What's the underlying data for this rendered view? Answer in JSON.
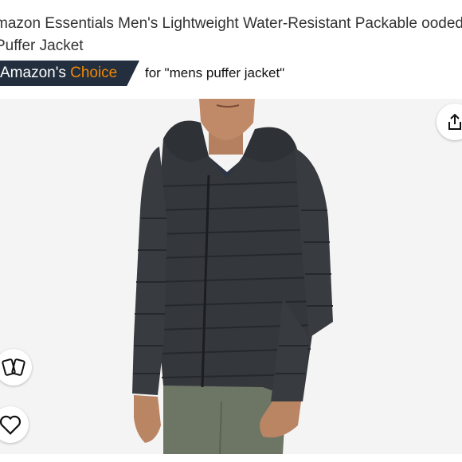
{
  "product": {
    "title": "mazon Essentials Men's Lightweight Water-Resistant Packable ooded Puffer Jacket"
  },
  "badge": {
    "prefix": "Amazon's",
    "highlight": "Choice",
    "highlight_color": "#f08804",
    "background_color": "#232f3e",
    "query_text": "for \"mens puffer jacket\""
  },
  "image": {
    "background_color": "#f4f4f4",
    "subject": "man-in-dark-puffer-jacket"
  },
  "actions": {
    "share_icon": "share-icon",
    "compare_icon": "compare-cards-icon",
    "wishlist_icon": "heart-icon"
  }
}
